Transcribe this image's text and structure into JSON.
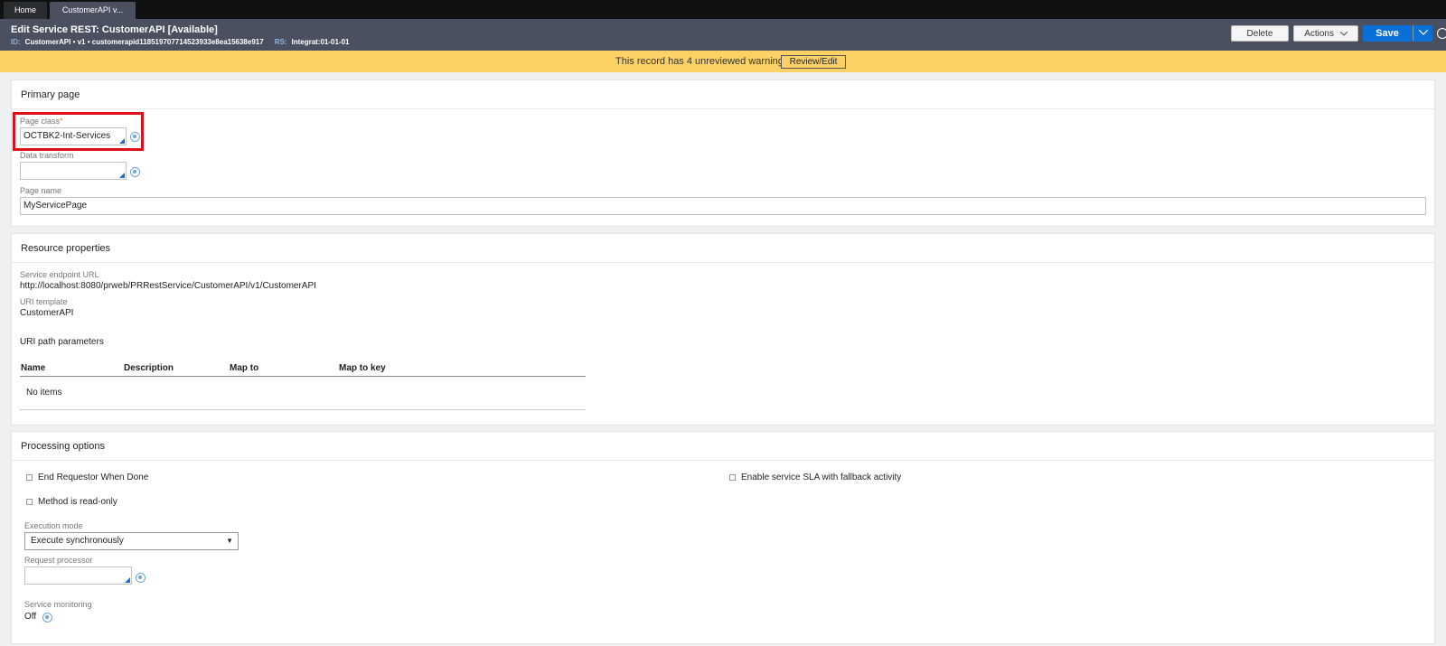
{
  "tabs": [
    {
      "label": "Home"
    },
    {
      "label": "CustomerAPI v..."
    }
  ],
  "header": {
    "title": "Edit  Service REST:  CustomerAPI  [Available]",
    "id_label": "ID:",
    "id_value": "CustomerAPI • v1 • customerapid118519707714523933e8ea15638e917",
    "rs_label": "RS:",
    "rs_value": "Integrat:01-01-01",
    "delete_label": "Delete",
    "actions_label": "Actions",
    "save_label": "Save"
  },
  "warning": {
    "text": "This record has 4 unreviewed warnings",
    "button_label": "Review/Edit"
  },
  "primary_page": {
    "title": "Primary page",
    "page_class_label": "Page class",
    "required_mark": "*",
    "page_class_value": "OCTBK2-Int-Services",
    "data_transform_label": "Data transform",
    "data_transform_value": "",
    "page_name_label": "Page name",
    "page_name_value": "MyServicePage"
  },
  "resource": {
    "title": "Resource properties",
    "endpoint_label": "Service endpoint URL",
    "endpoint_value": "http://localhost:8080/prweb/PRRestService/CustomerAPI/v1/CustomerAPI",
    "uri_template_label": "URI template",
    "uri_template_value": "CustomerAPI",
    "path_params_label": "URI path parameters",
    "columns": [
      "Name",
      "Description",
      "Map to",
      "Map to key"
    ],
    "empty_text": "No items"
  },
  "processing": {
    "title": "Processing options",
    "end_requestor_label": "End Requestor When Done",
    "read_only_label": "Method is read-only",
    "sla_label": "Enable service SLA with fallback activity",
    "execution_mode_label": "Execution mode",
    "execution_mode_value": "Execute synchronously",
    "request_processor_label": "Request processor",
    "request_processor_value": "",
    "monitoring_label": "Service monitoring",
    "monitoring_value": "Off"
  }
}
